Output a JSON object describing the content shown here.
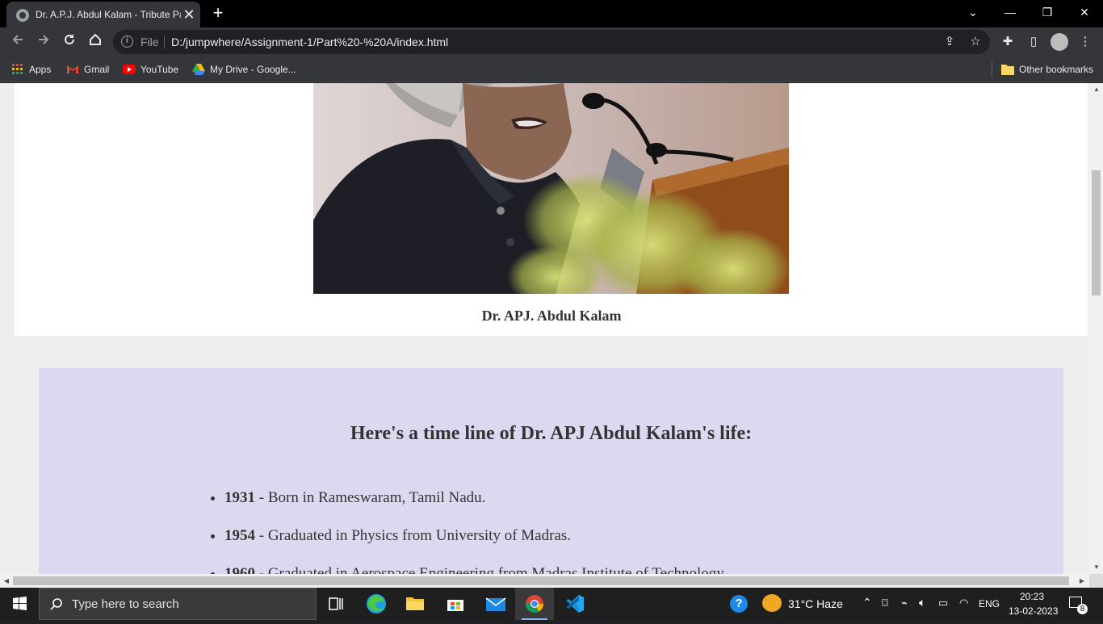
{
  "browser": {
    "tab_title": "Dr. A.P.J. Abdul Kalam - Tribute Page",
    "tab_close": "✕",
    "new_tab": "+",
    "window_controls": {
      "minimize": "—",
      "restore": "❐",
      "close": "✕",
      "dropdown": "⌄"
    },
    "url_label": "File",
    "url": "D:/jumpwhere/Assignment-1/Part%20-%20A/index.html",
    "bookmarks": [
      {
        "label": "Apps",
        "icon": "apps-grid-icon"
      },
      {
        "label": "Gmail",
        "icon": "gmail-icon"
      },
      {
        "label": "YouTube",
        "icon": "youtube-icon"
      },
      {
        "label": "My Drive - Google...",
        "icon": "drive-icon"
      }
    ],
    "other_bookmarks": "Other bookmarks"
  },
  "page": {
    "caption": "Dr. APJ. Abdul Kalam",
    "timeline_heading": "Here's a time line of Dr. APJ Abdul Kalam's life:",
    "timeline": [
      {
        "year": "1931",
        "text": " - Born in Rameswaram, Tamil Nadu."
      },
      {
        "year": "1954",
        "text": " - Graduated in Physics from University of Madras."
      },
      {
        "year": "1960",
        "text": " - Graduated in Aerospace Engineering from Madras Institute of Technology."
      }
    ]
  },
  "taskbar": {
    "search_placeholder": "Type here to search",
    "weather": "31°C  Haze",
    "language": "ENG",
    "time": "20:23",
    "date": "13-02-2023",
    "notification_count": "8"
  },
  "colors": {
    "timeline_bg": "#dcd8f0",
    "page_bg": "#eeeeee",
    "chrome_dark": "#35363a"
  }
}
